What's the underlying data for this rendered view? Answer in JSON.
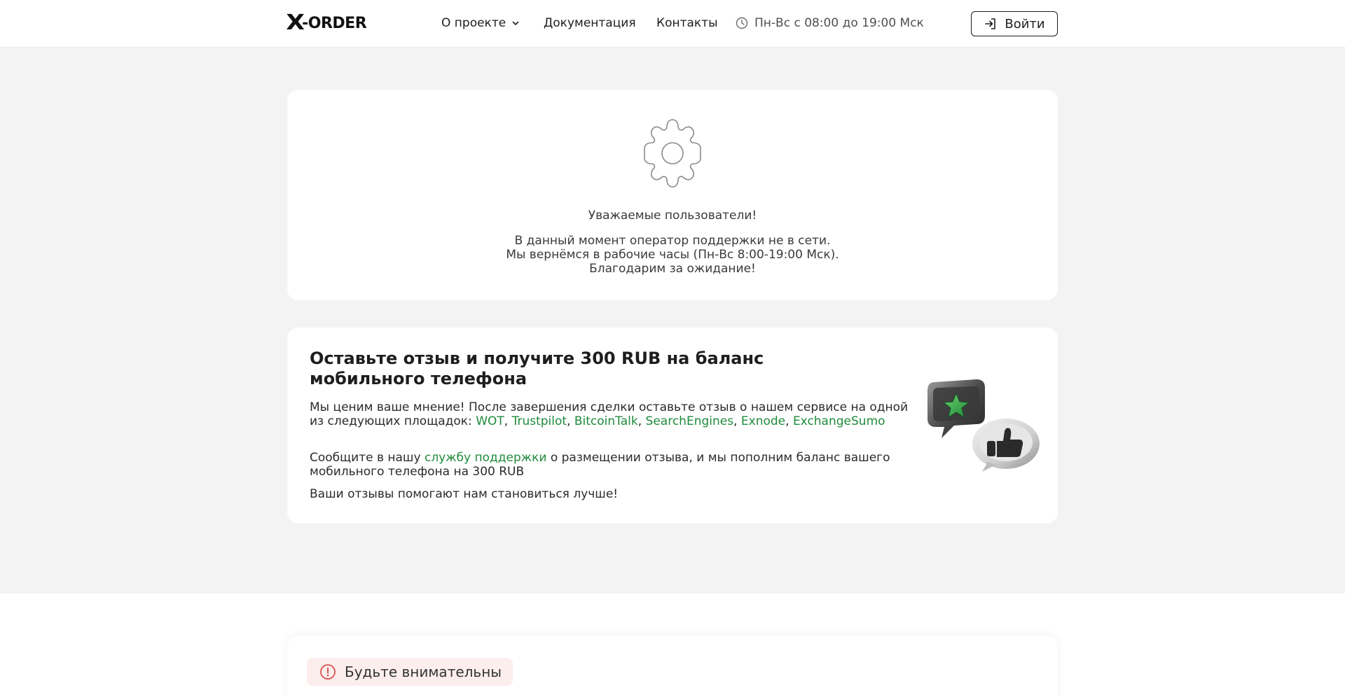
{
  "header": {
    "logo_x": "X",
    "logo_text": "-ORDER",
    "nav": {
      "about": "О проекте",
      "docs": "Документация",
      "contacts": "Контакты"
    },
    "hours": "Пн-Вс с 08:00 до 19:00 Мск",
    "login_label": "Войти"
  },
  "notice": {
    "greeting": "Уважаемые пользователи!",
    "line1": "В данный момент оператор поддержки не в сети.",
    "line2": "Мы вернёмся в рабочие часы (Пн-Вс 8:00-19:00 Мск).",
    "line3": "Благодарим за ожидание!"
  },
  "review": {
    "title": "Оставьте отзыв и получите 300 RUB на баланс мобильного телефона",
    "p1_text": "Мы ценим ваше мнение! После завершения сделки оставьте отзыв о нашем сервисе на одной из следующих площадок: ",
    "links": [
      "WOT",
      "Trustpilot",
      "BitcoinTalk",
      "SearchEngines",
      "Exnode",
      "ExchangeSumo"
    ],
    "p2_before": "Сообщите в нашу ",
    "p2_link": "службу поддержки",
    "p2_after": " о размещении отзыва, и мы пополним баланс вашего мобильного телефона на 300 RUB",
    "p3": "Ваши отзывы помогают нам становиться лучше!"
  },
  "warning": {
    "label": "Будьте внимательны"
  },
  "colors": {
    "accent_green": "#1f8a3b",
    "background": "#f3f3f4",
    "warning_bg": "#fdeeee",
    "warning_icon": "#d9534f"
  },
  "icons": {
    "about_chevron": "chevron-down-icon",
    "hours": "clock-icon",
    "login": "login-arrow-icon",
    "notice": "gear-icon",
    "review_illustration": "chat-bubbles-star-thumbs-up-icon",
    "warning": "alert-circle-icon"
  }
}
